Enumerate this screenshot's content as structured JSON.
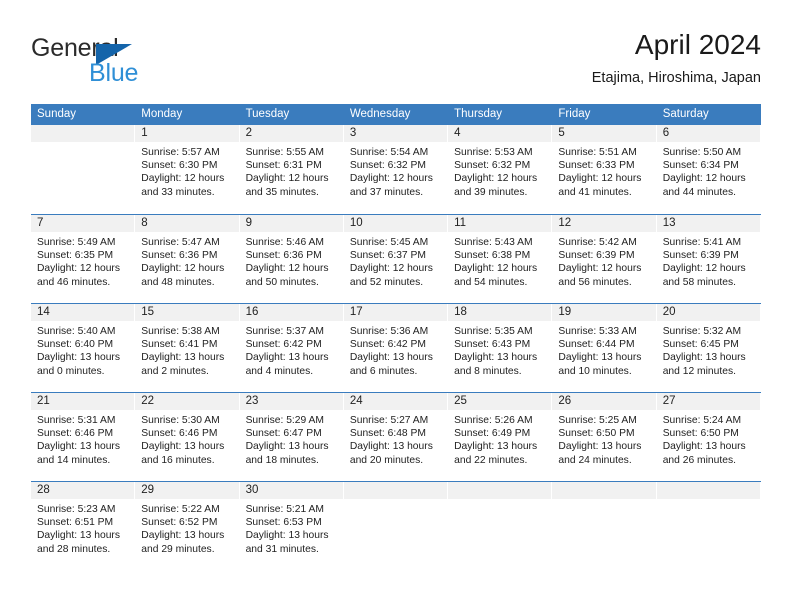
{
  "brand": {
    "word_one": "General",
    "word_two": "Blue"
  },
  "header": {
    "title": "April 2024",
    "subtitle": "Etajima, Hiroshima, Japan"
  },
  "colors": {
    "header_blue": "#3a7cbe",
    "logo_blue": "#2f8fd6",
    "logo_triangle": "#1464aa",
    "day_band": "#f1f1f1"
  },
  "weekdays": [
    "Sunday",
    "Monday",
    "Tuesday",
    "Wednesday",
    "Thursday",
    "Friday",
    "Saturday"
  ],
  "weeks": [
    [
      {
        "day": "",
        "sunrise": "",
        "sunset": "",
        "daylight": "",
        "empty": true
      },
      {
        "day": "1",
        "sunrise": "Sunrise: 5:57 AM",
        "sunset": "Sunset: 6:30 PM",
        "daylight": "Daylight: 12 hours and 33 minutes."
      },
      {
        "day": "2",
        "sunrise": "Sunrise: 5:55 AM",
        "sunset": "Sunset: 6:31 PM",
        "daylight": "Daylight: 12 hours and 35 minutes."
      },
      {
        "day": "3",
        "sunrise": "Sunrise: 5:54 AM",
        "sunset": "Sunset: 6:32 PM",
        "daylight": "Daylight: 12 hours and 37 minutes."
      },
      {
        "day": "4",
        "sunrise": "Sunrise: 5:53 AM",
        "sunset": "Sunset: 6:32 PM",
        "daylight": "Daylight: 12 hours and 39 minutes."
      },
      {
        "day": "5",
        "sunrise": "Sunrise: 5:51 AM",
        "sunset": "Sunset: 6:33 PM",
        "daylight": "Daylight: 12 hours and 41 minutes."
      },
      {
        "day": "6",
        "sunrise": "Sunrise: 5:50 AM",
        "sunset": "Sunset: 6:34 PM",
        "daylight": "Daylight: 12 hours and 44 minutes."
      }
    ],
    [
      {
        "day": "7",
        "sunrise": "Sunrise: 5:49 AM",
        "sunset": "Sunset: 6:35 PM",
        "daylight": "Daylight: 12 hours and 46 minutes."
      },
      {
        "day": "8",
        "sunrise": "Sunrise: 5:47 AM",
        "sunset": "Sunset: 6:36 PM",
        "daylight": "Daylight: 12 hours and 48 minutes."
      },
      {
        "day": "9",
        "sunrise": "Sunrise: 5:46 AM",
        "sunset": "Sunset: 6:36 PM",
        "daylight": "Daylight: 12 hours and 50 minutes."
      },
      {
        "day": "10",
        "sunrise": "Sunrise: 5:45 AM",
        "sunset": "Sunset: 6:37 PM",
        "daylight": "Daylight: 12 hours and 52 minutes."
      },
      {
        "day": "11",
        "sunrise": "Sunrise: 5:43 AM",
        "sunset": "Sunset: 6:38 PM",
        "daylight": "Daylight: 12 hours and 54 minutes."
      },
      {
        "day": "12",
        "sunrise": "Sunrise: 5:42 AM",
        "sunset": "Sunset: 6:39 PM",
        "daylight": "Daylight: 12 hours and 56 minutes."
      },
      {
        "day": "13",
        "sunrise": "Sunrise: 5:41 AM",
        "sunset": "Sunset: 6:39 PM",
        "daylight": "Daylight: 12 hours and 58 minutes."
      }
    ],
    [
      {
        "day": "14",
        "sunrise": "Sunrise: 5:40 AM",
        "sunset": "Sunset: 6:40 PM",
        "daylight": "Daylight: 13 hours and 0 minutes."
      },
      {
        "day": "15",
        "sunrise": "Sunrise: 5:38 AM",
        "sunset": "Sunset: 6:41 PM",
        "daylight": "Daylight: 13 hours and 2 minutes."
      },
      {
        "day": "16",
        "sunrise": "Sunrise: 5:37 AM",
        "sunset": "Sunset: 6:42 PM",
        "daylight": "Daylight: 13 hours and 4 minutes."
      },
      {
        "day": "17",
        "sunrise": "Sunrise: 5:36 AM",
        "sunset": "Sunset: 6:42 PM",
        "daylight": "Daylight: 13 hours and 6 minutes."
      },
      {
        "day": "18",
        "sunrise": "Sunrise: 5:35 AM",
        "sunset": "Sunset: 6:43 PM",
        "daylight": "Daylight: 13 hours and 8 minutes."
      },
      {
        "day": "19",
        "sunrise": "Sunrise: 5:33 AM",
        "sunset": "Sunset: 6:44 PM",
        "daylight": "Daylight: 13 hours and 10 minutes."
      },
      {
        "day": "20",
        "sunrise": "Sunrise: 5:32 AM",
        "sunset": "Sunset: 6:45 PM",
        "daylight": "Daylight: 13 hours and 12 minutes."
      }
    ],
    [
      {
        "day": "21",
        "sunrise": "Sunrise: 5:31 AM",
        "sunset": "Sunset: 6:46 PM",
        "daylight": "Daylight: 13 hours and 14 minutes."
      },
      {
        "day": "22",
        "sunrise": "Sunrise: 5:30 AM",
        "sunset": "Sunset: 6:46 PM",
        "daylight": "Daylight: 13 hours and 16 minutes."
      },
      {
        "day": "23",
        "sunrise": "Sunrise: 5:29 AM",
        "sunset": "Sunset: 6:47 PM",
        "daylight": "Daylight: 13 hours and 18 minutes."
      },
      {
        "day": "24",
        "sunrise": "Sunrise: 5:27 AM",
        "sunset": "Sunset: 6:48 PM",
        "daylight": "Daylight: 13 hours and 20 minutes."
      },
      {
        "day": "25",
        "sunrise": "Sunrise: 5:26 AM",
        "sunset": "Sunset: 6:49 PM",
        "daylight": "Daylight: 13 hours and 22 minutes."
      },
      {
        "day": "26",
        "sunrise": "Sunrise: 5:25 AM",
        "sunset": "Sunset: 6:50 PM",
        "daylight": "Daylight: 13 hours and 24 minutes."
      },
      {
        "day": "27",
        "sunrise": "Sunrise: 5:24 AM",
        "sunset": "Sunset: 6:50 PM",
        "daylight": "Daylight: 13 hours and 26 minutes."
      }
    ],
    [
      {
        "day": "28",
        "sunrise": "Sunrise: 5:23 AM",
        "sunset": "Sunset: 6:51 PM",
        "daylight": "Daylight: 13 hours and 28 minutes."
      },
      {
        "day": "29",
        "sunrise": "Sunrise: 5:22 AM",
        "sunset": "Sunset: 6:52 PM",
        "daylight": "Daylight: 13 hours and 29 minutes."
      },
      {
        "day": "30",
        "sunrise": "Sunrise: 5:21 AM",
        "sunset": "Sunset: 6:53 PM",
        "daylight": "Daylight: 13 hours and 31 minutes."
      },
      {
        "day": "",
        "sunrise": "",
        "sunset": "",
        "daylight": "",
        "empty": true
      },
      {
        "day": "",
        "sunrise": "",
        "sunset": "",
        "daylight": "",
        "empty": true
      },
      {
        "day": "",
        "sunrise": "",
        "sunset": "",
        "daylight": "",
        "empty": true
      },
      {
        "day": "",
        "sunrise": "",
        "sunset": "",
        "daylight": "",
        "empty": true
      }
    ]
  ]
}
